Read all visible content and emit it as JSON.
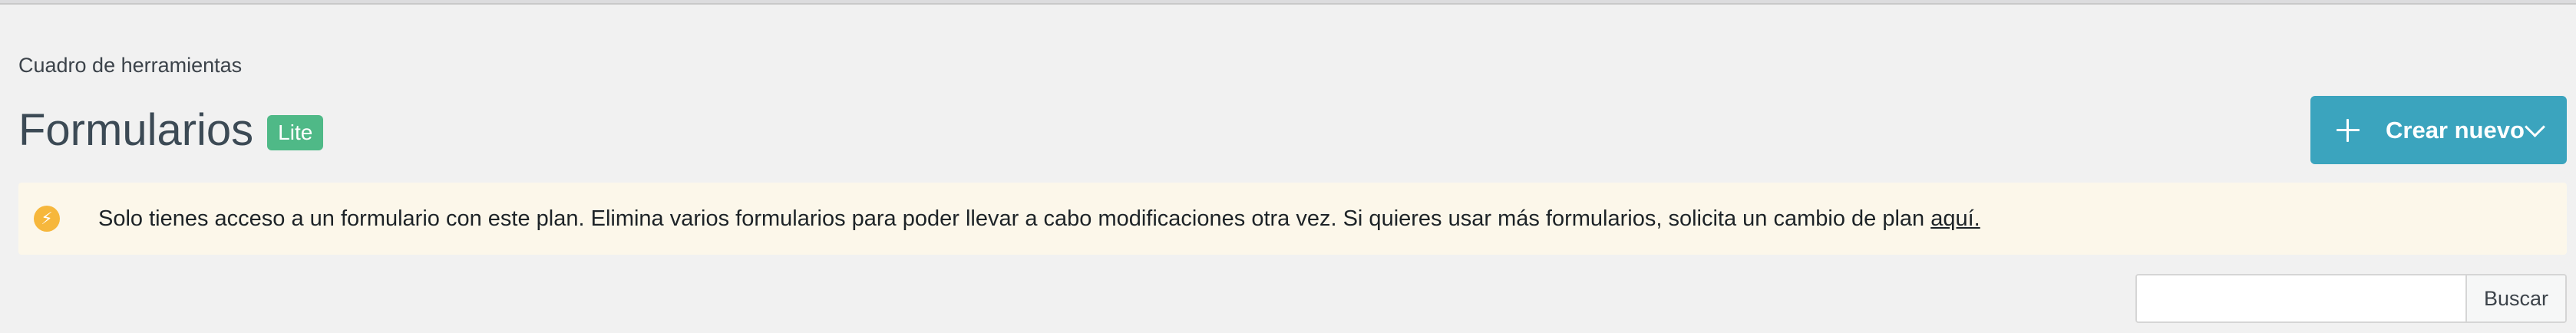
{
  "header": {
    "breadcrumb": "Cuadro de herramientas",
    "title": "Formularios",
    "badge": "Lite"
  },
  "actions": {
    "create_label": "Crear nuevo"
  },
  "notice": {
    "text": "Solo tienes acceso a un formulario con este plan. Elimina varios formularios para poder llevar a cabo modificaciones otra vez. Si quieres usar más formularios, solicita un cambio de plan ",
    "link_text": "aquí.",
    "icon": "lightning-icon",
    "icon_color": "#f6b73c"
  },
  "search": {
    "value": "",
    "button_label": "Buscar"
  },
  "colors": {
    "primary": "#3ba4be",
    "badge": "#4fb987",
    "notice_bg": "#fcf7ea"
  }
}
